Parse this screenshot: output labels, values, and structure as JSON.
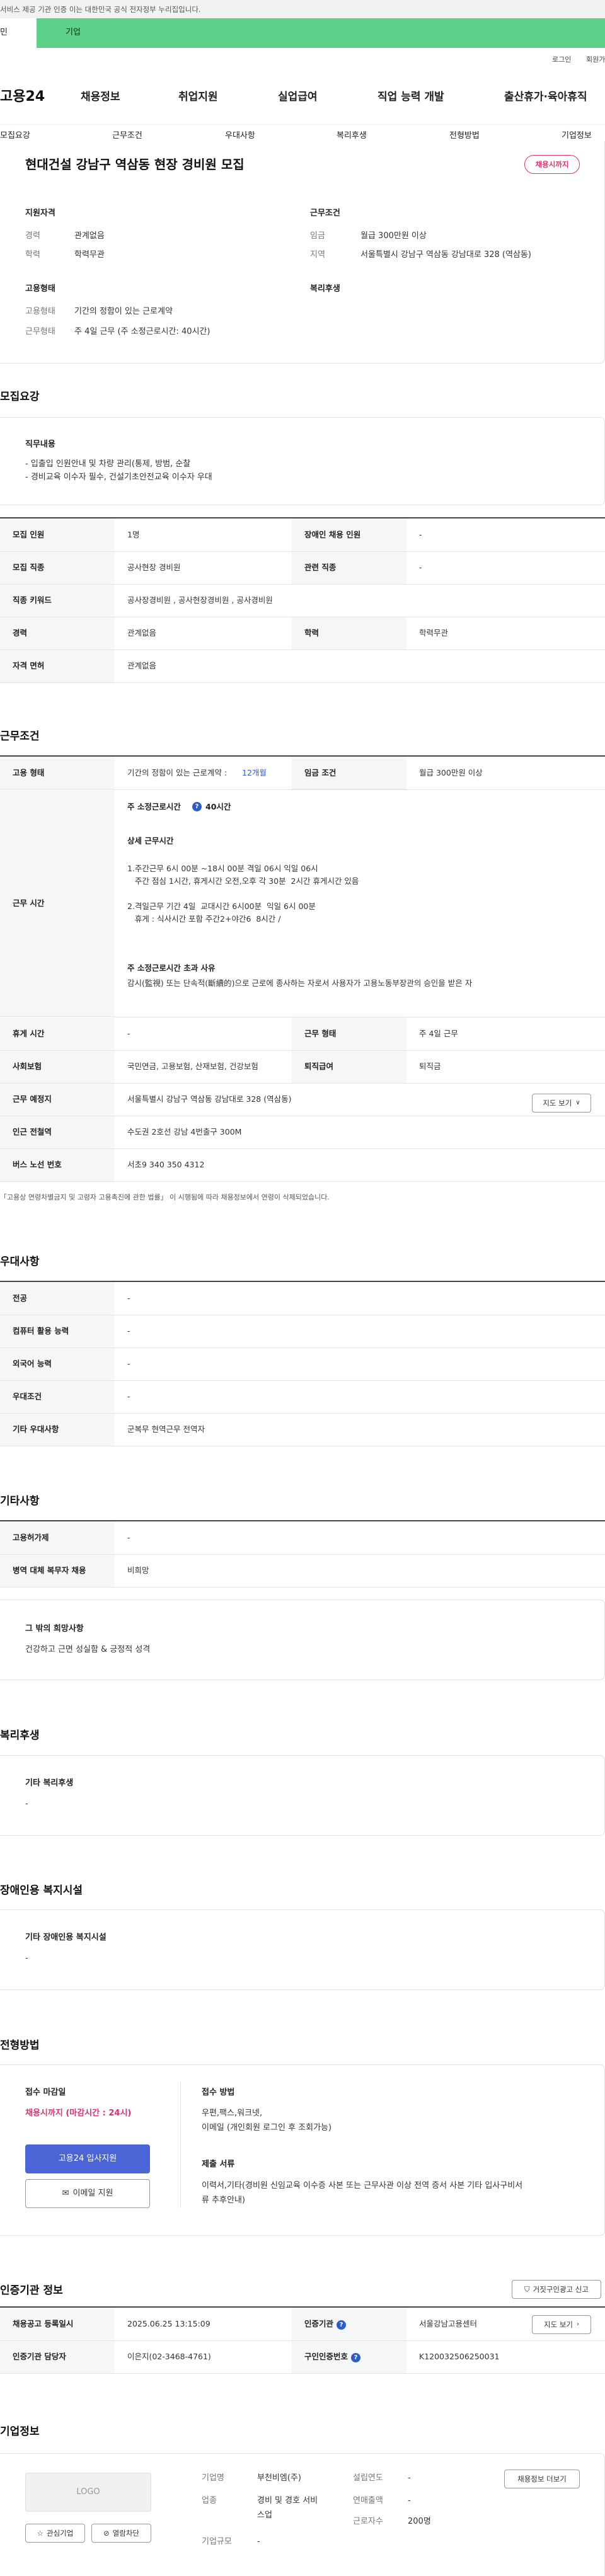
{
  "topbar": {
    "notice": "서비스 제공 기관 인증 이는 대한민국 공식 전자정부 누리집입니다."
  },
  "gov_bar": {
    "left": "민",
    "right": "기업"
  },
  "util": {
    "login": "로그인",
    "join": "회원가입"
  },
  "gnb": {
    "logo": "고용24",
    "menu": [
      "채용정보",
      "취업지원",
      "실업급여",
      "직업 능력 개발",
      "출산휴가·육아휴직"
    ]
  },
  "tabs": [
    "모집요강",
    "근무조건",
    "우대사항",
    "복리후생",
    "전형방법",
    "기업정보"
  ],
  "summary": {
    "title": "현대건설 강남구 역삼동 현장 경비원 모집",
    "badge": "채용시까지",
    "qual_title": "지원자격",
    "cond_title": "근무조건",
    "emp_title": "고용형태",
    "welfare_title": "복리후생",
    "career_label": "경력",
    "career": "관계없음",
    "edu_label": "학력",
    "edu": "학력무관",
    "wage_label": "임금",
    "wage": "월급 300만원 이상",
    "region_label": "지역",
    "region": "서울특별시 강남구 역삼동 강남대로 328 (역삼동)",
    "emp_type_label": "고용형태",
    "emp_type": "기간의 정함이 있는 근로계약",
    "work_type_label": "근무형태",
    "work_type": "주 4일 근무 (주 소정근로시간: 40시간)"
  },
  "recruit": {
    "title": "모집요강",
    "duty_title": "직무내용",
    "duty_lines": [
      "- 입출입 인원안내 및 차량 관리(통제, 방범, 순찰",
      "- 경비교육 이수자 필수, 건설기초안전교육 이수자 우대"
    ],
    "rows": [
      {
        "k1": "모집 인원",
        "v1": "1명",
        "k2": "장애인 채용 인원",
        "v2": "-"
      },
      {
        "k1": "모집 직종",
        "v1": "공사현장 경비원",
        "k2": "관련 직종",
        "v2": "-"
      },
      {
        "k1": "직종 키워드",
        "v1": "공사장경비원 , 공사현장경비원 , 공사경비원",
        "k2": "",
        "v2": ""
      },
      {
        "k1": "경력",
        "v1": "관계없음",
        "k2": "학력",
        "v2": "학력무관"
      },
      {
        "k1": "자격 면허",
        "v1": "관계없음",
        "k2": "",
        "v2": ""
      }
    ]
  },
  "work": {
    "title": "근무조건",
    "emp_label": "고용 형태",
    "emp_value": "기간의 정함이 있는 근로계약 : ",
    "emp_months": "12개월",
    "wage_label": "임금 조건",
    "wage_value": "월급 300만원 이상",
    "time_label": "근무 시간",
    "std_hours_title": "주 소정근로시간",
    "std_hours_value": "40시간",
    "detail_title": "상세 근무시간",
    "detail_lines": [
      "1.주간근무 6시 00분 ~18시 00분 격일 06시 익일 06시",
      "   주간 점심 1시간, 휴게시간 오전,오후 각 30분  2시간 휴게시간 있음",
      "",
      "2.격일근무 기간 4일  교대시간 6시00분  익일 6시 00분",
      "   휴게 : 식사시간 포함 주간2+야간6  8시간 /"
    ],
    "over_title": "주 소정근로시간 초과 사유",
    "over_text": "감시(監視) 또는 단속적(斷續的)으로 근로에 종사하는 자로서 사용자가 고용노동부장관의 승인을 받은 자",
    "rest_label": "휴게 시간",
    "rest_value": "-",
    "form_label": "근무 형태",
    "form_value": "주 4일 근무",
    "ins_label": "사회보험",
    "ins_value": "국민연금, 고용보험, 산재보험, 건강보험",
    "sev_label": "퇴직급여",
    "sev_value": "퇴직금",
    "place_label": "근무 예정지",
    "place_value": "서울특별시 강남구 역삼동 강남대로 328 (역삼동)",
    "map_btn": "지도 보기",
    "sub_label": "인근 전철역",
    "sub_value": "수도권 2호선 강남 4번출구 300M",
    "bus_label": "버스 노선 번호",
    "bus_value": "서초9 340 350 4312",
    "note": "「고용상 연령차별금지 및 고령자 고용촉진에 관한 법률」 이 시행됨에 따라 채용정보에서 연령이 삭제되었습니다."
  },
  "pref": {
    "title": "우대사항",
    "rows": [
      {
        "k": "전공",
        "v": "-"
      },
      {
        "k": "컴퓨터 활용 능력",
        "v": "-"
      },
      {
        "k": "외국어 능력",
        "v": "-"
      },
      {
        "k": "우대조건",
        "v": "-"
      },
      {
        "k": "기타 우대사항",
        "v": "군복무 현역근무 전역자"
      }
    ]
  },
  "etc": {
    "title": "기타사항",
    "rows": [
      {
        "k": "고용허가제",
        "v": "-"
      },
      {
        "k": "병역 대체 복무자 채용",
        "v": "비희망"
      }
    ],
    "box_title": "그 밖의 희망사항",
    "box_text": "건강하고 근면 성실함 & 긍정적 성격"
  },
  "welfare": {
    "title": "복리후생",
    "box_title": "기타 복리후생",
    "box_text": "-"
  },
  "disab": {
    "title": "장애인용 복지시설",
    "box_title": "기타 장애인용 복지시설",
    "box_text": "-"
  },
  "apply": {
    "title": "전형방법",
    "deadline_title": "접수 마감일",
    "deadline": "채용시까지 (마감시간 : 24시)",
    "apply_btn": "고용24 입사지원",
    "email_btn": "이메일 지원",
    "method_title": "접수 방법",
    "method_lines": [
      "우편,팩스,워크넷,",
      "이메일 (개인회원 로그인 후 조회가능)"
    ],
    "docs_title": "제출 서류",
    "docs_lines": [
      "이력서,기타(경비원 신임교육 이수증 사본 또는 근무사관 이상 전역 증서 사본 기타 입사구비서",
      "류 추후안내)"
    ]
  },
  "cert": {
    "title": "인증기관 정보",
    "report_btn": "거짓구인광고 신고",
    "rows": [
      {
        "k1": "채용공고 등록일시",
        "v1": "2025.06.25 13:15:09",
        "k2": "인증기관",
        "v2": "서울강남고용센터",
        "btn": "지도 보기"
      },
      {
        "k1": "인증기관 담당자",
        "v1": "이은지(02-3468-4761)",
        "k2": "구인인증번호",
        "v2": "K120032506250031",
        "btn": ""
      }
    ]
  },
  "company": {
    "title": "기업정보",
    "logo": "LOGO",
    "fav_btn": "관심기업",
    "block_btn": "열람차단",
    "name_label": "기업명",
    "name": "부천비엠(주)",
    "industry_label": "업종",
    "industry_lines": [
      "경비 및 경호 서비",
      "스업"
    ],
    "scale_label": "기업규모",
    "scale": "-",
    "year_label": "설립연도",
    "year": "-",
    "sales_label": "연매출액",
    "sales": "-",
    "emp_label": "근로자수",
    "emp": "200명",
    "jobs_btn": "채용정보 더보기"
  }
}
